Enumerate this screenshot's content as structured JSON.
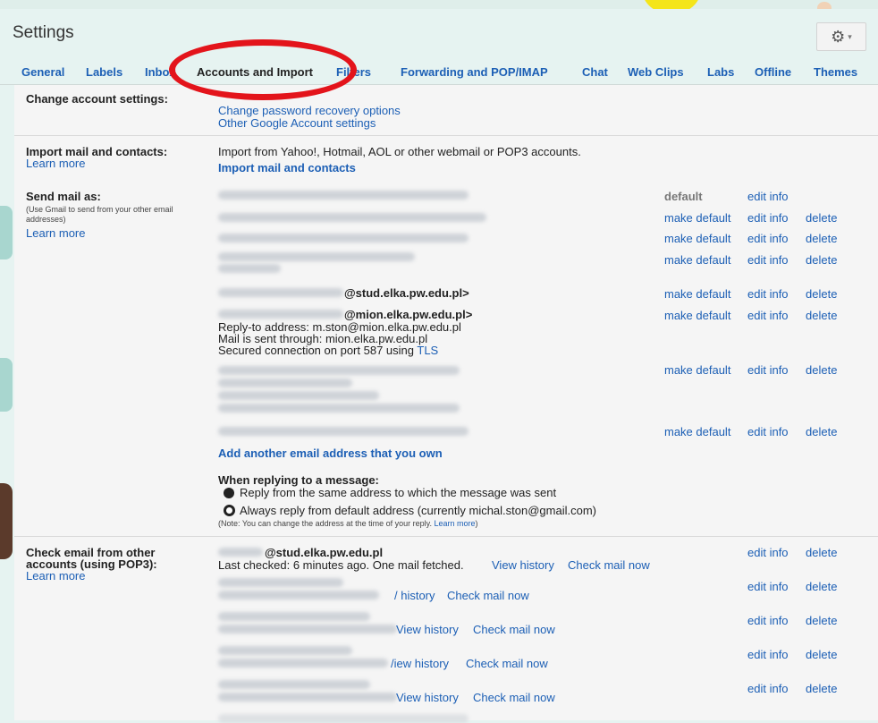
{
  "window": {
    "title": "Settings"
  },
  "tabs": [
    "General",
    "Labels",
    "Inbox",
    "Accounts and Import",
    "Filters",
    "Forwarding and POP/IMAP",
    "Chat",
    "Web Clips",
    "Labs",
    "Offline",
    "Themes"
  ],
  "change_account": {
    "label": "Change account settings:",
    "links": [
      "Change password recovery options",
      "Other Google Account settings"
    ]
  },
  "import": {
    "label": "Import mail and contacts:",
    "learn_more": "Learn more",
    "desc": "Import from Yahoo!, Hotmail, AOL or other webmail or POP3 accounts.",
    "action": "Import mail and contacts"
  },
  "send_as": {
    "label": "Send mail as:",
    "note": "(Use Gmail to send from your other email addresses)",
    "learn_more": "Learn more",
    "default_text": "default",
    "make_default": "make default",
    "edit_info": "edit info",
    "delete": "delete",
    "addr_stud": "@stud.elka.pw.edu.pl>",
    "addr_mion": "@mion.elka.pw.edu.pl>",
    "reply_to": "Reply-to address: m.ston@mion.elka.pw.edu.pl",
    "sent_through": "Mail is sent through: mion.elka.pw.edu.pl",
    "secured": "Secured connection on port 587 using",
    "tls": "TLS",
    "add_another": "Add another email address that you own",
    "replying_heading": "When replying to a message:",
    "option_same": "Reply from the same address to which the message was sent",
    "option_default": "Always reply from default address (currently michal.ston@gmail.com)",
    "note_change": "(Note: You can change the address at the time of your reply.",
    "note_learn": "Learn more",
    "note_close": ")"
  },
  "pop3": {
    "label_line1": "Check email from other",
    "label_line2": "accounts (using POP3):",
    "learn_more": "Learn more",
    "account": "@stud.elka.pw.edu.pl",
    "last_checked": "Last checked: 6 minutes ago. One mail fetched.",
    "view_history": "View history",
    "check_mail_now": "Check mail now",
    "edit_info": "edit info",
    "delete": "delete",
    "partial_1": "/ history",
    "partial_2": "View history",
    "partial_3": "/iew history",
    "partial_4": "View history"
  }
}
